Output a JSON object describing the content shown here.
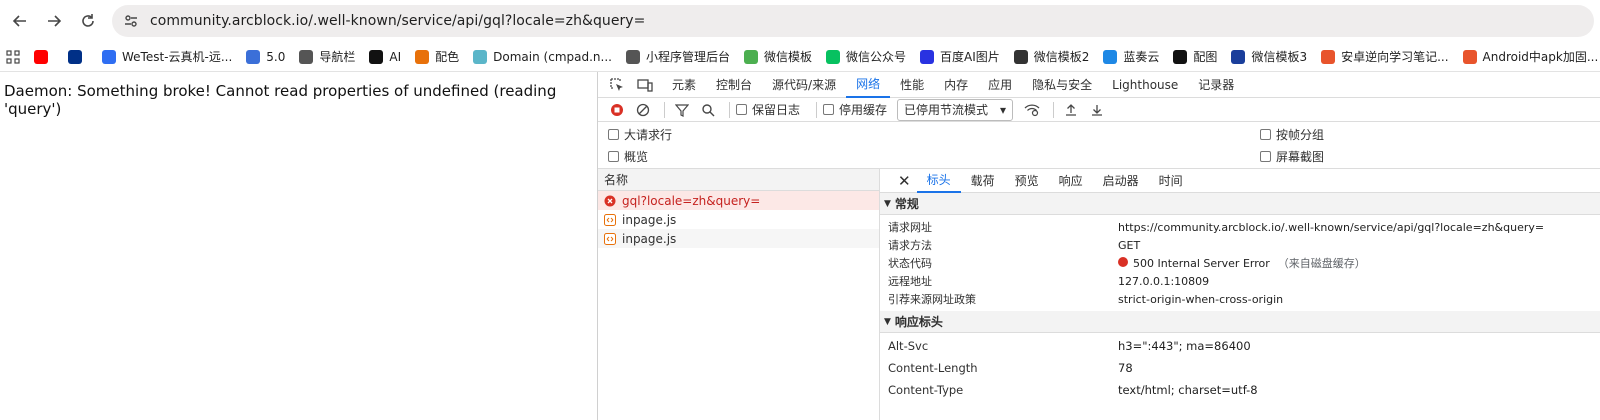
{
  "browser": {
    "url_host": "community.arcblock.io",
    "url_path": "/.well-known/service/api/gql?locale=zh&query=",
    "bookmarks": [
      {
        "label": "",
        "icon": "youtube-icon",
        "color": "#ff0000"
      },
      {
        "label": "",
        "icon": "paypal-icon",
        "color": "#003087"
      },
      {
        "label": "WeTest-云真机-远...",
        "icon": "wetest-icon",
        "color": "#2f6ef2"
      },
      {
        "label": "5.0",
        "icon": "badge-icon",
        "color": "#3b6fd8"
      },
      {
        "label": "导航栏",
        "icon": "globe-icon",
        "color": "#555555"
      },
      {
        "label": "AI",
        "icon": "k-icon",
        "color": "#111111"
      },
      {
        "label": "配色",
        "icon": "palette-icon",
        "color": "#e8710a"
      },
      {
        "label": "Domain (cmpad.n...",
        "icon": "domain-icon",
        "color": "#5bb6c9"
      },
      {
        "label": "小程序管理后台",
        "icon": "globe-icon",
        "color": "#555555"
      },
      {
        "label": "微信模板",
        "icon": "dots-icon",
        "color": "#4caf50"
      },
      {
        "label": "微信公众号",
        "icon": "wechat-icon",
        "color": "#07c160"
      },
      {
        "label": "百度AI图片",
        "icon": "baidu-icon",
        "color": "#2932e1"
      },
      {
        "label": "微信模板2",
        "icon": "m-icon",
        "color": "#333333"
      },
      {
        "label": "蓝奏云",
        "icon": "cloud-icon",
        "color": "#1e88e5"
      },
      {
        "label": "配图",
        "icon": "circle-icon",
        "color": "#111111"
      },
      {
        "label": "微信模板3",
        "icon": "n-icon",
        "color": "#1a3e9b"
      },
      {
        "label": "安卓逆向学习笔记...",
        "icon": "c-icon",
        "color": "#e8542c"
      },
      {
        "label": "Android中apk加固...",
        "icon": "c-icon",
        "color": "#e8542c"
      }
    ]
  },
  "page": {
    "message": "Daemon: Something broke! Cannot read properties of undefined (reading 'query')"
  },
  "devtools": {
    "tabs": [
      "元素",
      "控制台",
      "源代码/来源",
      "网络",
      "性能",
      "内存",
      "应用",
      "隐私与安全",
      "Lighthouse",
      "记录器"
    ],
    "active_tab": "网络",
    "toolbar": {
      "preserve_log": "保留日志",
      "disable_cache": "停用缓存",
      "throttle": "已停用节流模式"
    },
    "options": {
      "large_rows": "大请求行",
      "overview": "概览",
      "group_by_frame": "按帧分组",
      "screenshots": "屏幕截图"
    },
    "list_header": "名称",
    "requests": [
      {
        "name": "gql?locale=zh&query=",
        "status": "error"
      },
      {
        "name": "inpage.js",
        "status": "ok"
      },
      {
        "name": "inpage.js",
        "status": "ok"
      }
    ],
    "detail_tabs": [
      "标头",
      "载荷",
      "预览",
      "响应",
      "启动器",
      "时间"
    ],
    "active_detail_tab": "标头",
    "general": {
      "title": "常规",
      "rows": [
        {
          "k": "请求网址",
          "v": "https://community.arcblock.io/.well-known/service/api/gql?locale=zh&query="
        },
        {
          "k": "请求方法",
          "v": "GET"
        },
        {
          "k": "状态代码",
          "v": "500 Internal Server Error",
          "note": "（来自磁盘缓存）"
        },
        {
          "k": "远程地址",
          "v": "127.0.0.1:10809"
        },
        {
          "k": "引荐来源网址政策",
          "v": "strict-origin-when-cross-origin"
        }
      ]
    },
    "response_headers": {
      "title": "响应标头",
      "rows": [
        {
          "k": "Alt-Svc",
          "v": "h3=\":443\"; ma=86400"
        },
        {
          "k": "Content-Length",
          "v": "78"
        },
        {
          "k": "Content-Type",
          "v": "text/html; charset=utf-8"
        }
      ]
    }
  }
}
